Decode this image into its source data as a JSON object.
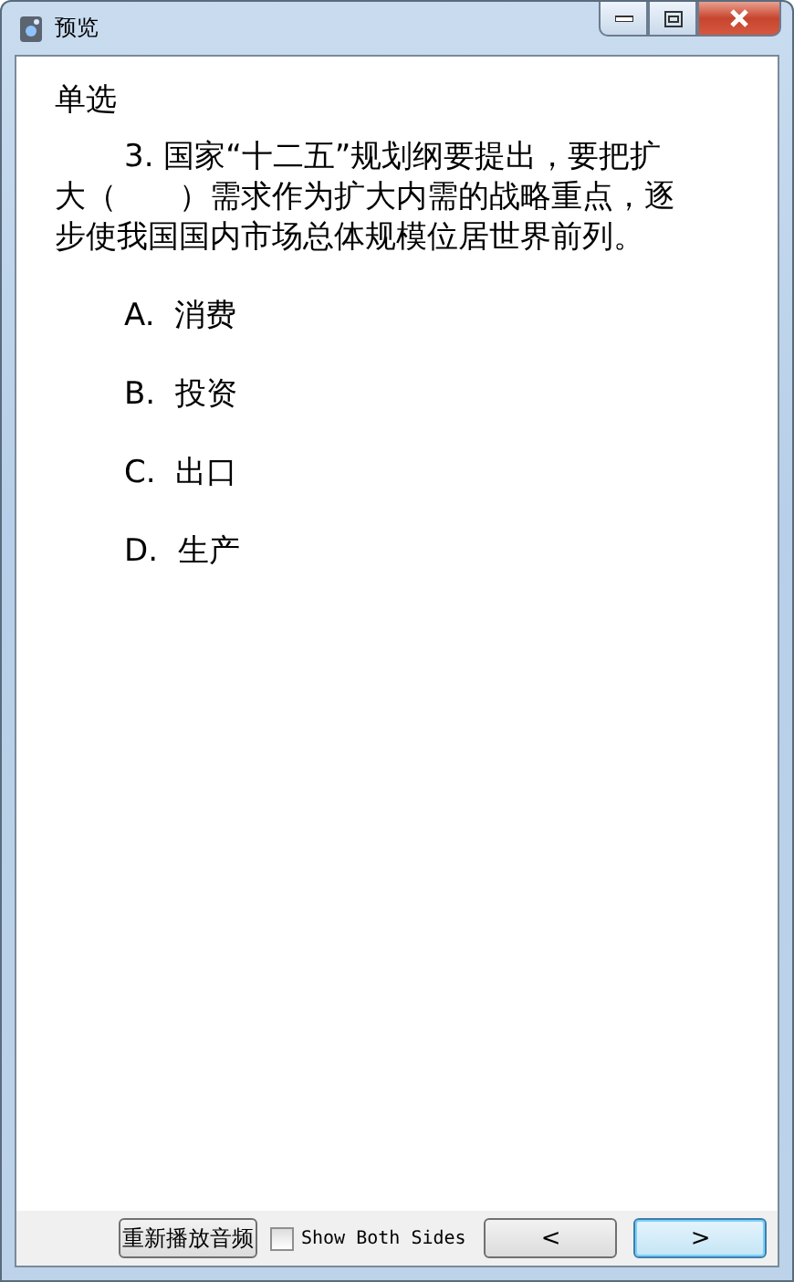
{
  "window": {
    "title": "预览"
  },
  "question": {
    "type": "单选",
    "text": "3. 国家“十二五”规划纲要提出，要把扩大（　　）需求作为扩大内需的战略重点，逐步使我国国内市场总体规模位居世界前列。"
  },
  "options": [
    {
      "letter": "A.",
      "text": "消费",
      "selected": false
    },
    {
      "letter": "B.",
      "text": "投资",
      "selected": false
    },
    {
      "letter": "C.",
      "text": "出口",
      "selected": false
    },
    {
      "letter": "D.",
      "text": "生产",
      "selected": false
    }
  ],
  "footer": {
    "replay_button": "重新播放音频",
    "show_both_sides": {
      "label": "Show Both Sides",
      "checked": false
    },
    "prev_button": {
      "label": "<",
      "focused": false
    },
    "next_button": {
      "label": ">",
      "focused": true
    }
  }
}
